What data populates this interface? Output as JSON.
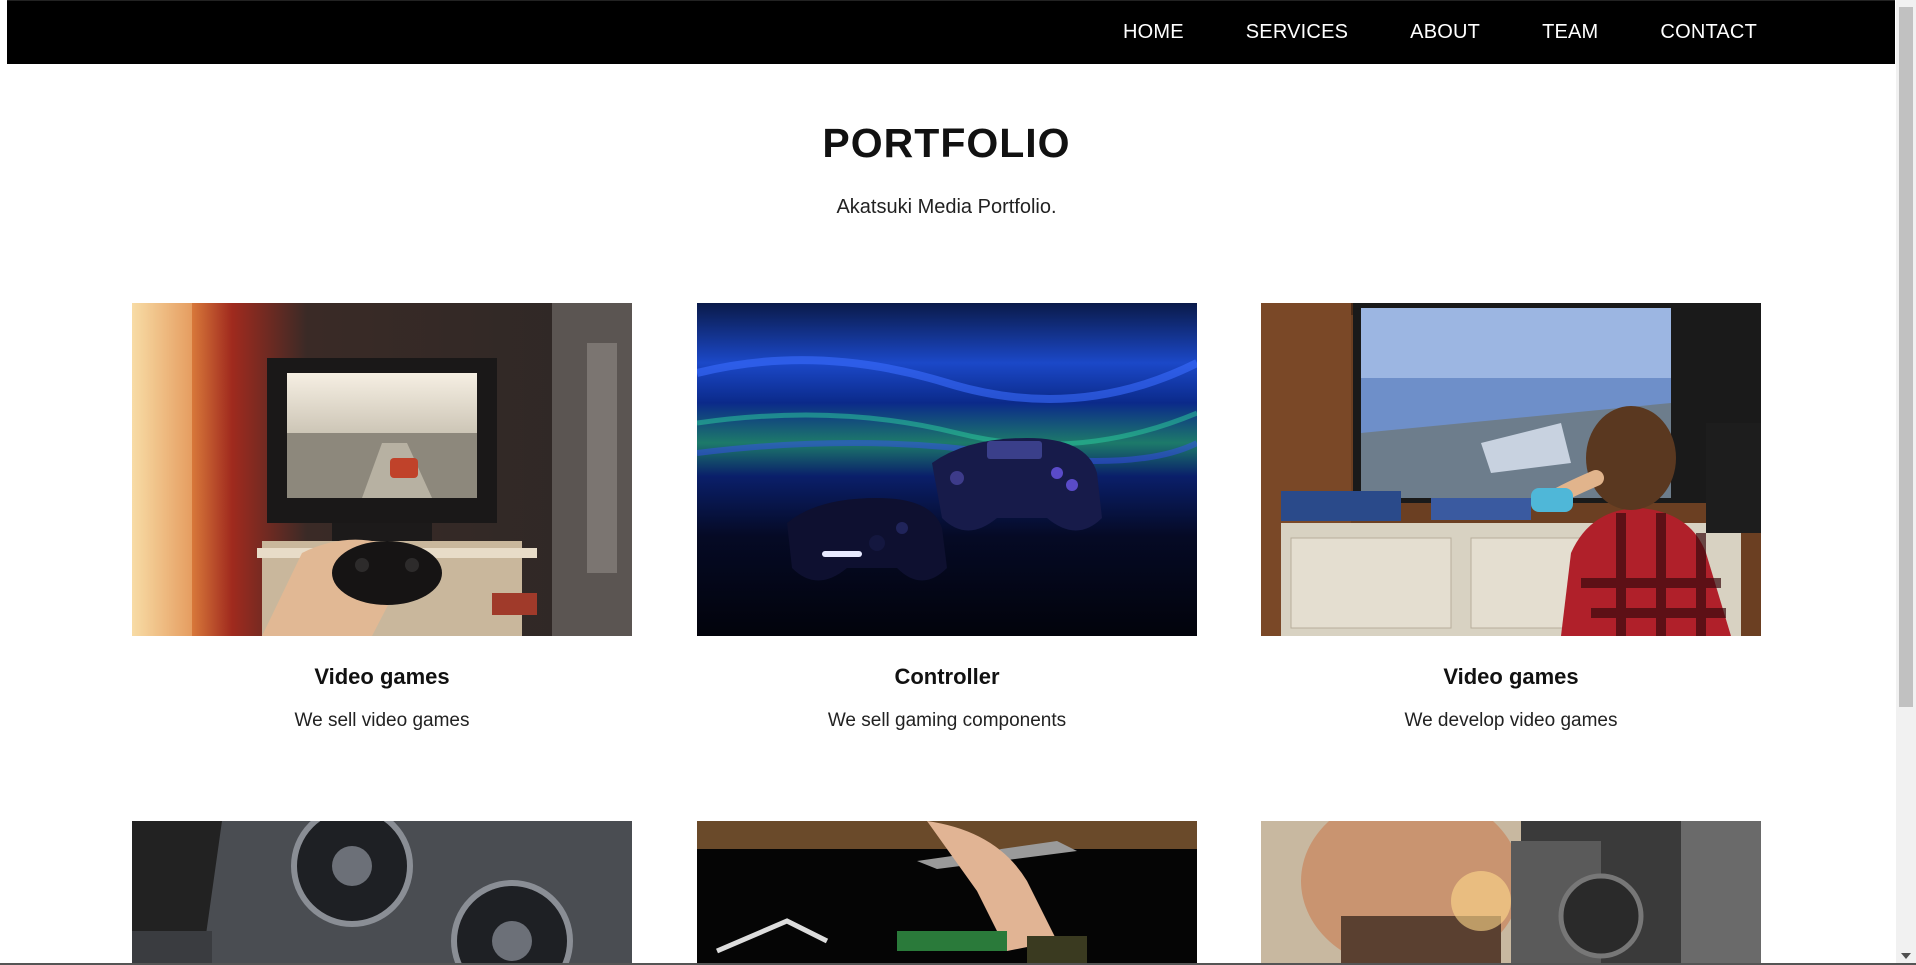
{
  "nav": {
    "items": [
      {
        "label": "HOME"
      },
      {
        "label": "SERVICES"
      },
      {
        "label": "ABOUT"
      },
      {
        "label": "TEAM"
      },
      {
        "label": "CONTACT"
      }
    ]
  },
  "portfolio": {
    "title": "PORTFOLIO",
    "subtitle": "Akatsuki Media Portfolio.",
    "cards": [
      {
        "title": "Video games",
        "description": "We sell video games"
      },
      {
        "title": "Controller",
        "description": "We sell gaming components"
      },
      {
        "title": "Video games",
        "description": "We develop video games"
      }
    ]
  }
}
